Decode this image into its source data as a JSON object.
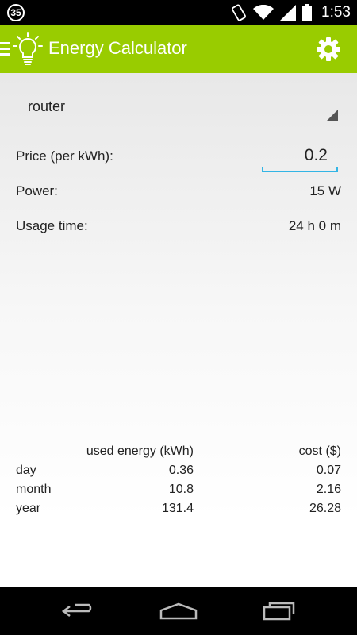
{
  "status_bar": {
    "notification_count": "35",
    "time": "1:53"
  },
  "action_bar": {
    "title": "Energy Calculator"
  },
  "device_select": {
    "value": "router"
  },
  "price": {
    "label": "Price (per kWh):",
    "value": "0.2"
  },
  "power": {
    "label": "Power:",
    "value": "15 W"
  },
  "usage": {
    "label": "Usage time:",
    "value": "24 h 0 m"
  },
  "results": {
    "headers": [
      "used energy (kWh)",
      "cost ($)"
    ],
    "rows": [
      {
        "period": "day",
        "energy": "0.36",
        "cost": "0.07"
      },
      {
        "period": "month",
        "energy": "10.8",
        "cost": "2.16"
      },
      {
        "period": "year",
        "energy": "131.4",
        "cost": "26.28"
      }
    ]
  },
  "colors": {
    "accent": "#99cc00",
    "input_focus": "#33b5e5"
  },
  "icons": [
    "menu-icon",
    "lightbulb-icon",
    "gear-icon",
    "back-icon",
    "home-icon",
    "recents-icon",
    "wifi-icon",
    "signal-icon",
    "battery-icon",
    "vibrate-icon"
  ]
}
